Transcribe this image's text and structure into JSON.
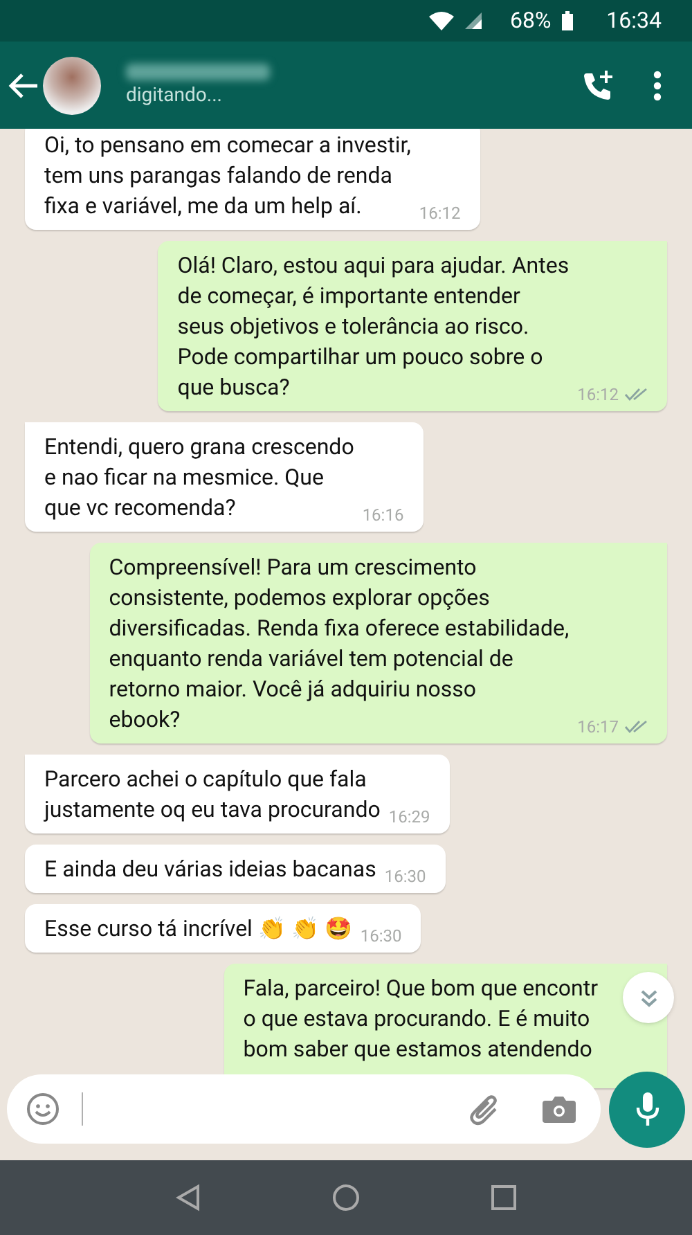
{
  "status_bar": {
    "battery": "68%",
    "time": "16:34"
  },
  "header": {
    "status": "digitando..."
  },
  "messages": [
    {
      "sent": false,
      "text": "Oi, to pensano em comecar a investir,\ntem uns parangas falando de renda\nfixa e variável, me da um help aí.",
      "time": "16:12",
      "tail": false
    },
    {
      "sent": true,
      "text": "Olá! Claro, estou aqui para ajudar. Antes\nde começar, é importante entender\nseus objetivos e tolerância ao risco.\nPode compartilhar um pouco sobre o\nque busca?",
      "time": "16:12",
      "double_tick": true,
      "tail": true
    },
    {
      "sent": false,
      "text": "Entendi, quero grana crescendo\ne nao ficar na mesmice. Que\nque vc recomenda?",
      "time": "16:16",
      "tail": true
    },
    {
      "sent": true,
      "text": "Compreensível! Para um crescimento\nconsistente, podemos explorar opções\ndiversificadas. Renda fixa oferece estabilidade,\nenquanto renda variável tem potencial de\nretorno maior. Você já adquiriu nosso\nebook?",
      "time": "16:17",
      "double_tick": true,
      "tail": true
    },
    {
      "sent": false,
      "text": "Parcero achei o capítulo que fala\njustamente oq eu tava procurando",
      "time": "16:29",
      "tail": true
    },
    {
      "sent": false,
      "text": "E ainda deu várias ideias bacanas",
      "time": "16:30",
      "tail": false
    },
    {
      "sent": false,
      "text": "Esse curso tá incrível 👏 👏 🤩",
      "time": "16:30",
      "tail": false
    },
    {
      "sent": true,
      "text": "Fala, parceiro! Que bom que encontr\no que estava procurando. E é muito\nbom saber que estamos atendendo",
      "tail": true,
      "cut": true
    }
  ]
}
